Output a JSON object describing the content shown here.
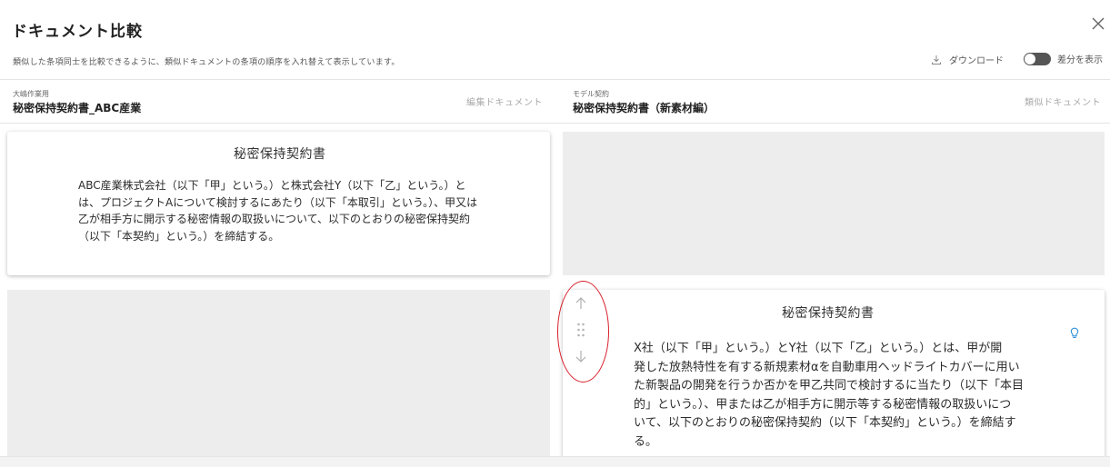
{
  "header": {
    "title": "ドキュメント比較",
    "subtitle": "類似した条項同士を比較できるように、類似ドキュメントの条項の順序を入れ替えて表示しています。",
    "download_label": "ダウンロード",
    "diff_toggle_label": "差分を表示"
  },
  "left_doc": {
    "company": "大嶋作業用",
    "name": "秘密保持契約書_ABC産業",
    "role": "編集ドキュメント"
  },
  "right_doc": {
    "company": "モデル契約",
    "name": "秘密保持契約書（新素材編）",
    "role": "類似ドキュメント"
  },
  "left_card": {
    "title": "秘密保持契約書",
    "lines": [
      "ABC産業株式会社（以下「甲」という。）と株式会社Y（以下「乙」という。）と",
      "は、プロジェクトAについて検討するにあたり（以下「本取引」という。）、甲又は",
      "乙が相手方に開示する秘密情報の取扱いについて、以下のとおりの秘密保持契約",
      "（以下「本契約」という。）を締結する。"
    ]
  },
  "right_card": {
    "title": "秘密保持契約書",
    "lines": [
      "X社（以下「甲」という。）とY社（以下「乙」という。）とは、甲が開",
      "発した放熱特性を有する新規素材αを自動車用ヘッドライトカバーに用い",
      "た新製品の開発を行うか否かを甲乙共同で検討するに当たり（以下「本目",
      "的」という。）、甲または乙が相手方に開示等する秘密情報の取扱いにつ",
      "いて、以下のとおりの秘密保持契約（以下「本契約」という。）を締結す",
      "る。"
    ]
  },
  "colors": {
    "highlight": "#d81e2a",
    "bulb": "#2a8fd6",
    "toggle_off": "#555555"
  },
  "icons": {
    "close": "close-icon",
    "download": "download-icon",
    "move_up": "arrow-up-icon",
    "drag": "drag-handle-icon",
    "move_down": "arrow-down-icon",
    "hint": "lightbulb-icon"
  }
}
